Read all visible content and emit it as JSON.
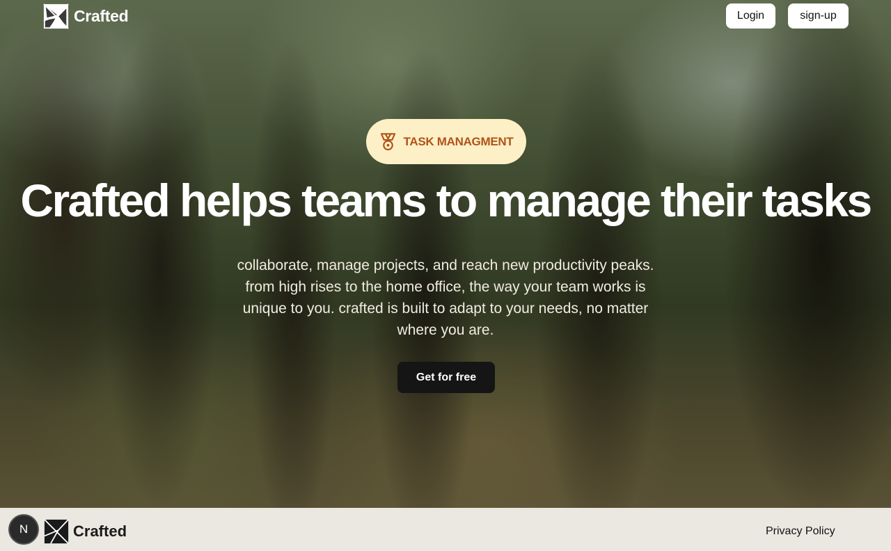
{
  "header": {
    "brand": "Crafted",
    "login_label": "Login",
    "signup_label": "sign-up"
  },
  "hero": {
    "badge_icon": "medal-icon",
    "badge_label": "TASK MANAGMENT",
    "headline": "Crafted helps teams to manage their tasks",
    "subtext_lines": [
      "collaborate, manage projects, and reach new productivity peaks.",
      "from high rises to the home office, the way your team works is",
      "unique to you. crafted is built to adapt to your needs, no matter",
      "where you are."
    ],
    "cta_label": "Get for free"
  },
  "footer": {
    "next_badge": "N",
    "brand": "Crafted",
    "privacy_label": "Privacy Policy"
  },
  "colors": {
    "badge_bg": "#fdf0c6",
    "badge_text": "#b0531a",
    "cta_bg": "#151515",
    "footer_bg": "#ebe8e1"
  }
}
